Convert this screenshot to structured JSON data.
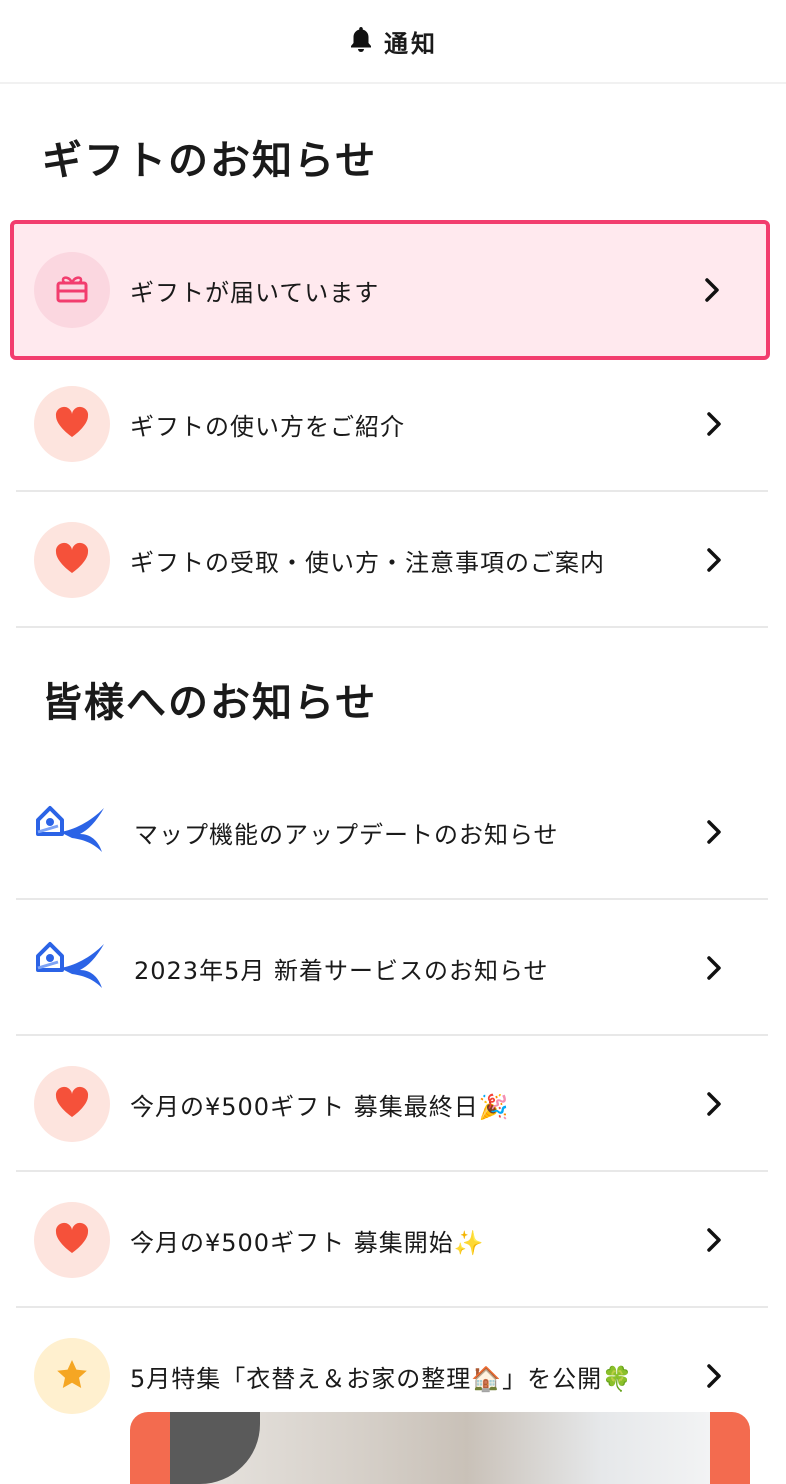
{
  "header": {
    "title": "通知",
    "icon": "bell-icon"
  },
  "sections": {
    "gift": {
      "title": "ギフトのお知らせ"
    },
    "all": {
      "title": "皆様へのお知らせ"
    }
  },
  "gift_items": [
    {
      "label": "ギフトが届いています",
      "icon": "gift-icon",
      "highlighted": true
    },
    {
      "label": "ギフトの使い方をご紹介",
      "icon": "heart-icon"
    },
    {
      "label": "ギフトの受取・使い方・注意事項のご案内",
      "icon": "heart-icon"
    }
  ],
  "news_items": [
    {
      "label": "マップ機能のアップデートのお知らせ",
      "icon": "house-bird-logo-icon"
    },
    {
      "label": "2023年5月 新着サービスのお知らせ",
      "icon": "house-bird-logo-icon"
    },
    {
      "label": "今月の¥500ギフト 募集最終日🎉",
      "icon": "heart-icon"
    },
    {
      "label": "今月の¥500ギフト 募集開始✨",
      "icon": "heart-icon"
    },
    {
      "label": "5月特集「衣替え＆お家の整理🏠」を公開🍀",
      "icon": "star-icon"
    }
  ],
  "colors": {
    "accent": "#f23d6e",
    "heart": "#f5513a",
    "star": "#f5a623",
    "logo": "#2b63e6"
  }
}
